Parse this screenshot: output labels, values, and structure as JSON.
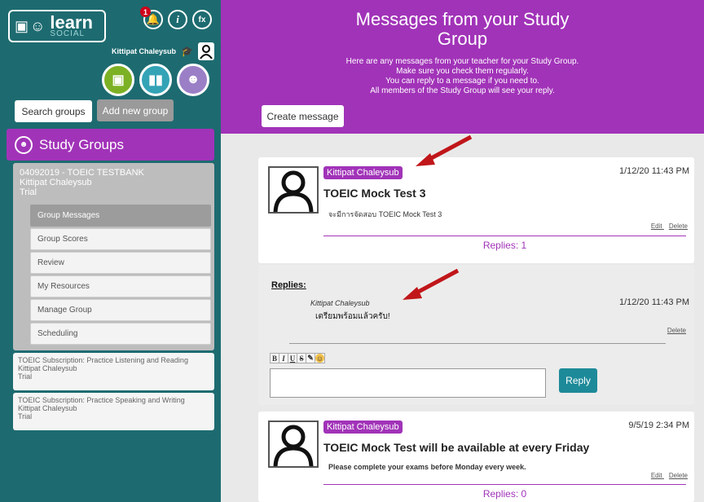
{
  "sidebar": {
    "logo": {
      "word1": "learn",
      "word2": "SOCIAL"
    },
    "notifications_badge": "1",
    "top_icons": {
      "info": "i",
      "fx": "fx"
    },
    "user_name": "Kittipat Chaleysub",
    "buttons": {
      "search": "Search groups",
      "add": "Add new group"
    },
    "study_groups_title": "Study Groups",
    "active_group": {
      "name": "04092019 - TOEIC TESTBANK",
      "owner": "Kittipat Chaleysub",
      "plan": "Trial",
      "items": [
        {
          "label": "Group Messages",
          "active": true
        },
        {
          "label": "Group Scores"
        },
        {
          "label": "Review"
        },
        {
          "label": "My Resources"
        },
        {
          "label": "Manage Group"
        },
        {
          "label": "Scheduling"
        }
      ]
    },
    "other_groups": [
      {
        "name": "TOEIC Subscription: Practice Listening and Reading",
        "owner": "Kittipat Chaleysub",
        "plan": "Trial"
      },
      {
        "name": "TOEIC Subscription: Practice Speaking and Writing",
        "owner": "Kittipat Chaleysub",
        "plan": "Trial"
      }
    ]
  },
  "main": {
    "title": "Messages from your Study Group",
    "description": [
      "Here are any messages from your teacher for your Study Group.",
      "Make sure you check them regularly.",
      "You can reply to a message if you need to.",
      "All members of the Study Group will see your reply."
    ],
    "create_label": "Create message",
    "messages": [
      {
        "author": "Kittipat Chaleysub",
        "time": "1/12/20 11:43 PM",
        "title": "TOEIC Mock Test 3",
        "body": "จะมีการจัดสอบ TOEIC Mock Test 3",
        "edit": "Edit",
        "delete": "Delete",
        "replies": "Replies: 1"
      },
      {
        "author": "Kittipat Chaleysub",
        "time": "9/5/19 2:34 PM",
        "title": "TOEIC Mock Test will be available at every Friday",
        "body": "Please complete your exams before Monday every week.",
        "edit": "Edit",
        "delete": "Delete",
        "replies": "Replies: 0"
      }
    ],
    "replies_section": {
      "label": "Replies:",
      "reply": {
        "author": "Kittipat Chaleysub",
        "time": "1/12/20 11:43 PM",
        "text": "เตรียมพร้อมแล้วครับ!",
        "delete": "Delete"
      },
      "toolbar": [
        "B",
        "I",
        "U",
        "S",
        "✎",
        "☺"
      ],
      "reply_button": "Reply"
    }
  },
  "colors": {
    "purple": "#a133b8",
    "teal": "#1d6b70",
    "reply_button": "#1d8a99",
    "arrow": "#c0161a"
  }
}
